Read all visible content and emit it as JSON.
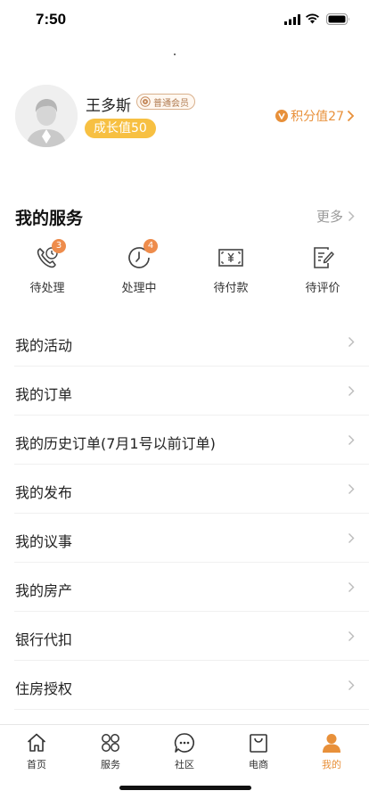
{
  "status_bar": {
    "time": "7:50"
  },
  "profile": {
    "name": "王多斯",
    "member_badge": "普通会员",
    "growth": "成长值50",
    "points": "积分值27"
  },
  "services": {
    "title": "我的服务",
    "more": "更多",
    "items": [
      {
        "label": "待处理",
        "icon": "phone-clock-icon",
        "badge": "3"
      },
      {
        "label": "处理中",
        "icon": "clock-icon",
        "badge": "4"
      },
      {
        "label": "待付款",
        "icon": "payment-icon",
        "badge": ""
      },
      {
        "label": "待评价",
        "icon": "review-icon",
        "badge": ""
      }
    ]
  },
  "menu": [
    {
      "label": "我的活动"
    },
    {
      "label": "我的订单"
    },
    {
      "label": "我的历史订单(7月1号以前订单)"
    },
    {
      "label": "我的发布"
    },
    {
      "label": "我的议事"
    },
    {
      "label": "我的房产"
    },
    {
      "label": "银行代扣"
    },
    {
      "label": "住房授权"
    }
  ],
  "tabs": [
    {
      "label": "首页",
      "icon": "home-icon",
      "active": false
    },
    {
      "label": "服务",
      "icon": "services-grid-icon",
      "active": false
    },
    {
      "label": "社区",
      "icon": "chat-bubble-icon",
      "active": false
    },
    {
      "label": "电商",
      "icon": "shopping-bag-icon",
      "active": false
    },
    {
      "label": "我的",
      "icon": "person-icon",
      "active": true
    }
  ],
  "colors": {
    "accent": "#e8903a",
    "growth_pill": "#f7c042",
    "badge": "#ee8c4c",
    "text": "#222222",
    "muted": "#999999"
  }
}
